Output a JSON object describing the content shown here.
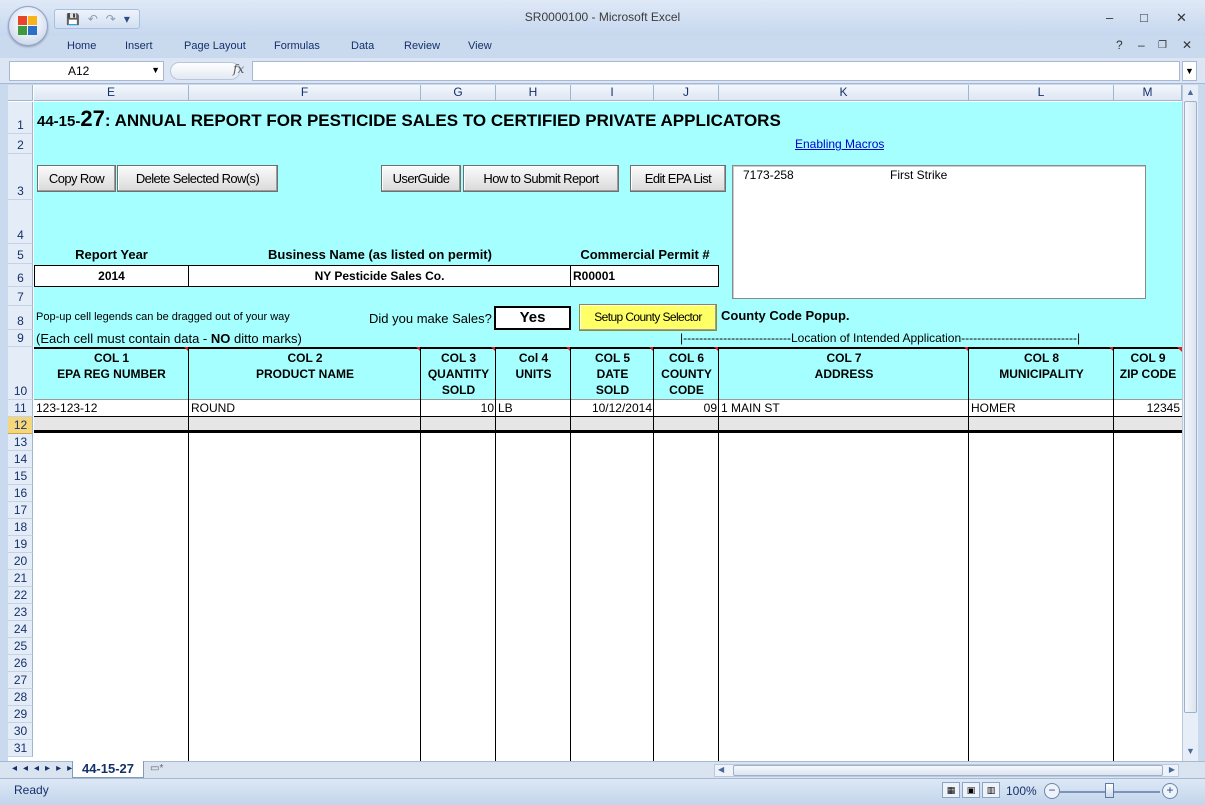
{
  "window": {
    "title": "SR0000100 - Microsoft Excel",
    "controls": [
      "–",
      "□",
      "✕"
    ],
    "doc_controls": [
      "?",
      "–",
      "❐",
      "✕"
    ]
  },
  "qat": {
    "save": "💾",
    "undo": "↶",
    "redo": "↷",
    "customize": "▾"
  },
  "ribbon": {
    "tabs": [
      "Home",
      "Insert",
      "Page Layout",
      "Formulas",
      "Data",
      "Review",
      "View"
    ]
  },
  "formula_bar": {
    "name_box": "A12",
    "fx": "fx",
    "formula": ""
  },
  "columns": [
    "E",
    "F",
    "G",
    "H",
    "I",
    "J",
    "K",
    "L",
    "M"
  ],
  "rows": [
    "1",
    "2",
    "3",
    "4",
    "5",
    "6",
    "7",
    "8",
    "9",
    "10",
    "11",
    "12",
    "13",
    "14",
    "15",
    "16",
    "17",
    "18",
    "19",
    "20",
    "21",
    "22",
    "23",
    "24",
    "25",
    "26",
    "27",
    "28",
    "29",
    "30",
    "31"
  ],
  "report": {
    "title_prefix": "44-15-",
    "title_num": "27",
    "title_rest": ": ANNUAL REPORT FOR PESTICIDE SALES TO CERTIFIED PRIVATE APPLICATORS",
    "link_macros": "Enabling Macros",
    "buttons": {
      "copy_row": "Copy Row",
      "delete_rows": "Delete Selected Row(s)",
      "user_guide": "UserGuide",
      "how_to_submit": "How to Submit Report",
      "edit_epa": "Edit EPA List",
      "setup_county": "Setup County Selector"
    },
    "epa_list": {
      "reg": "7173-258",
      "name": "First Strike"
    },
    "labels": {
      "report_year": "Report Year",
      "business_name": "Business Name (as listed on permit)",
      "permit": "Commercial Permit #",
      "popup_note": "Pop-up cell legends can be dragged out of your way",
      "did_sales": "Did you make Sales?",
      "county_popup": "County Code Popup.",
      "ditto_a": "(Each cell must contain data - ",
      "ditto_b": "NO",
      "ditto_c": " ditto marks)",
      "location": "|---------------------------Location of Intended Application-----------------------------|"
    },
    "values": {
      "report_year": "2014",
      "business_name": "NY Pesticide Sales Co.",
      "permit": "R00001",
      "sales": "Yes"
    },
    "headers": [
      {
        "l1": "COL 1",
        "l2": "EPA REG NUMBER",
        "l3": ""
      },
      {
        "l1": "COL 2",
        "l2": "PRODUCT NAME",
        "l3": ""
      },
      {
        "l1": "COL 3",
        "l2": "QUANTITY",
        "l3": "SOLD"
      },
      {
        "l1": "Col 4",
        "l2": "UNITS",
        "l3": ""
      },
      {
        "l1": "COL 5",
        "l2": "DATE",
        "l3": "SOLD"
      },
      {
        "l1": "COL 6",
        "l2": "COUNTY",
        "l3": "CODE"
      },
      {
        "l1": "COL 7",
        "l2": "ADDRESS",
        "l3": ""
      },
      {
        "l1": "COL 8",
        "l2": "MUNICIPALITY",
        "l3": ""
      },
      {
        "l1": "COL 9",
        "l2": "ZIP CODE",
        "l3": ""
      }
    ],
    "row11": [
      "123-123-12",
      "ROUND",
      "10",
      "LB",
      "10/12/2014",
      "09",
      "1 MAIN ST",
      "HOMER",
      "12345"
    ]
  },
  "sheet": {
    "tab": "44-15-27",
    "nav": "◂◂◂▸▸▸"
  },
  "status": {
    "ready": "Ready",
    "zoom": "100%"
  }
}
